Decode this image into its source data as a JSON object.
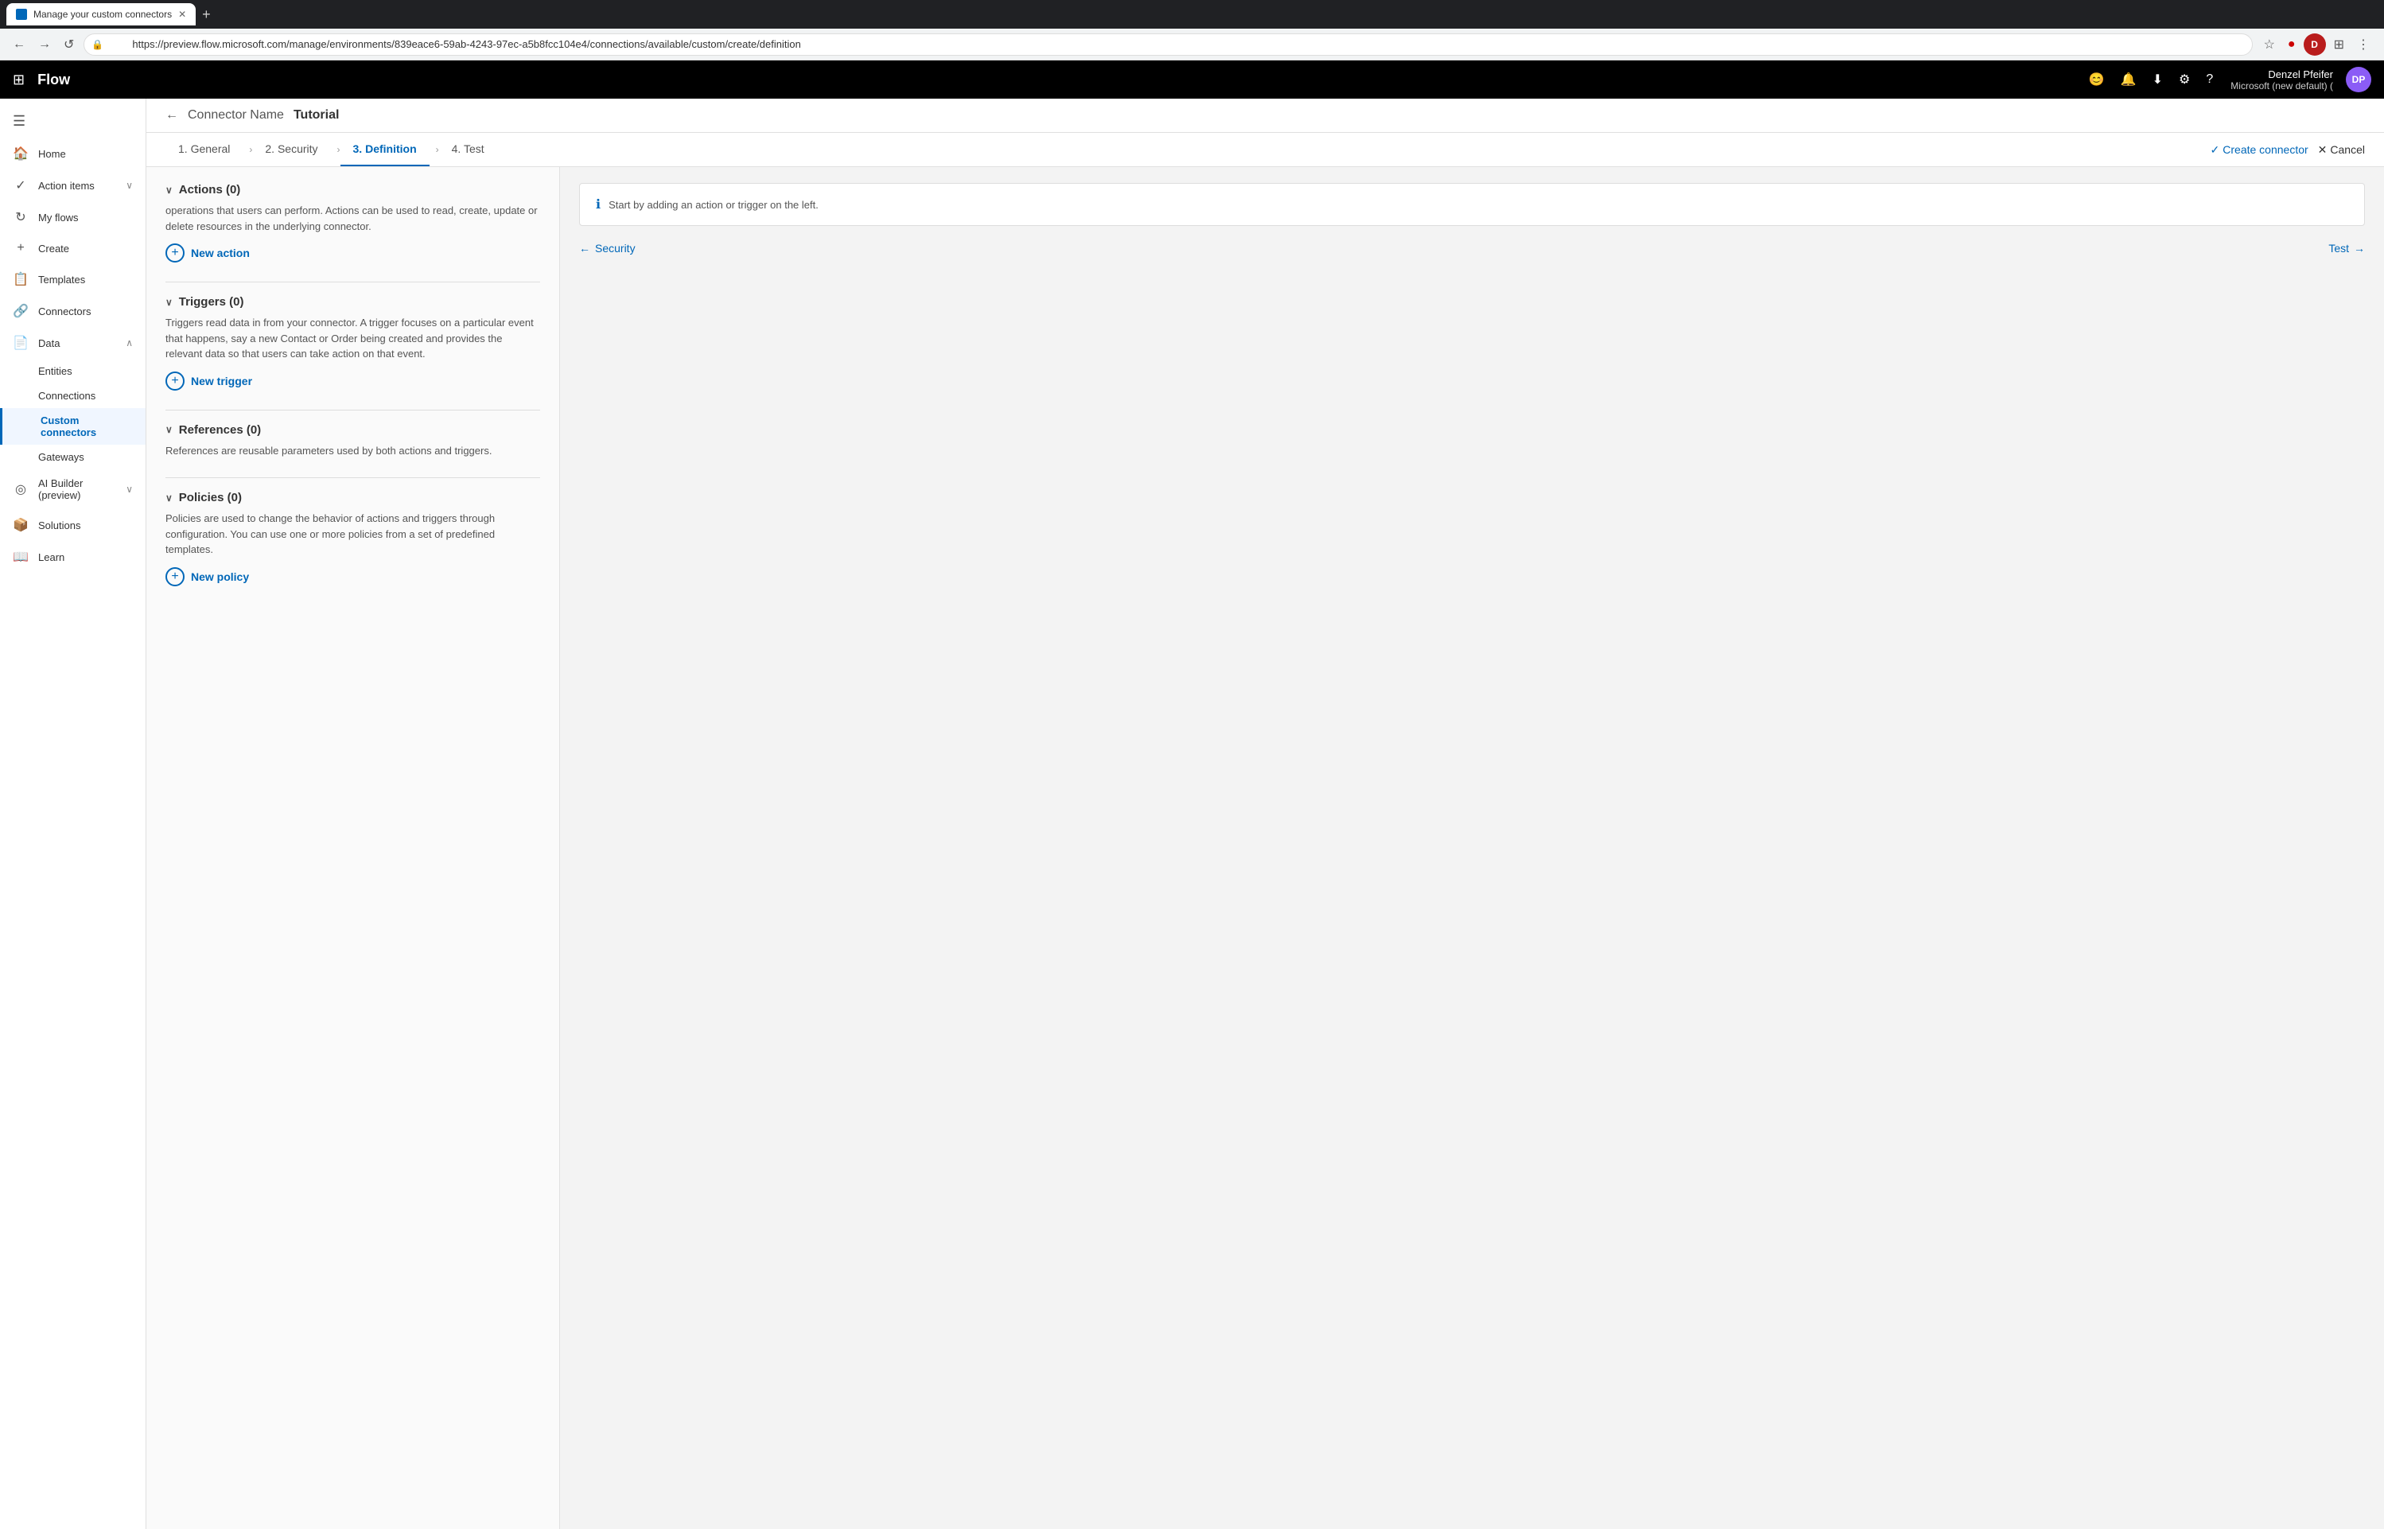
{
  "browser": {
    "tab_title": "Manage your custom connectors",
    "url": "https://preview.flow.microsoft.com/manage/environments/839eace6-59ab-4243-97ec-a5b8fcc104e4/connections/available/custom/create/definition",
    "nav_back_label": "←",
    "nav_forward_label": "→",
    "nav_refresh_label": "↺",
    "new_tab_label": "+"
  },
  "topnav": {
    "app_name": "Flow",
    "user_name": "Denzel Pfeifer",
    "user_tenant": "Microsoft (new default) (",
    "icons": [
      "😊",
      "🔔",
      "⬇",
      "⚙",
      "?"
    ],
    "avatar_initials": "DP"
  },
  "sidebar": {
    "hamburger_label": "☰",
    "items": [
      {
        "id": "home",
        "label": "Home",
        "icon": "🏠",
        "has_expand": false
      },
      {
        "id": "action-items",
        "label": "Action items",
        "icon": "✓",
        "has_expand": true
      },
      {
        "id": "my-flows",
        "label": "My flows",
        "icon": "↻",
        "has_expand": false
      },
      {
        "id": "create",
        "label": "Create",
        "icon": "+",
        "has_expand": false
      },
      {
        "id": "templates",
        "label": "Templates",
        "icon": "📋",
        "has_expand": false
      },
      {
        "id": "connectors",
        "label": "Connectors",
        "icon": "🔗",
        "has_expand": false
      },
      {
        "id": "data",
        "label": "Data",
        "icon": "📄",
        "has_expand": true
      },
      {
        "id": "entities",
        "label": "Entities",
        "icon": "",
        "is_sub": true
      },
      {
        "id": "connections",
        "label": "Connections",
        "icon": "",
        "is_sub": true
      },
      {
        "id": "custom-connectors",
        "label": "Custom connectors",
        "icon": "",
        "is_sub": true,
        "active": true
      },
      {
        "id": "gateways",
        "label": "Gateways",
        "icon": "",
        "is_sub": true
      },
      {
        "id": "ai-builder",
        "label": "AI Builder\n(preview)",
        "icon": "◎",
        "has_expand": true
      },
      {
        "id": "solutions",
        "label": "Solutions",
        "icon": "📦",
        "has_expand": false
      },
      {
        "id": "learn",
        "label": "Learn",
        "icon": "📖",
        "has_expand": false
      }
    ]
  },
  "connector_header": {
    "connector_name": "Connector Name",
    "title": "Tutorial",
    "back_icon": "←"
  },
  "wizard_tabs": [
    {
      "id": "general",
      "label": "1. General",
      "active": false
    },
    {
      "id": "security",
      "label": "2. Security",
      "active": false
    },
    {
      "id": "definition",
      "label": "3. Definition",
      "active": true
    },
    {
      "id": "test",
      "label": "4. Test",
      "active": false
    }
  ],
  "wizard_actions": {
    "create_label": "Create connector",
    "cancel_label": "Cancel"
  },
  "definition": {
    "actions_section": {
      "title": "Actions (0)",
      "description": "operations that users can perform. Actions can be used to read, create, update or delete resources in the underlying connector.",
      "add_label": "New action"
    },
    "triggers_section": {
      "title": "Triggers (0)",
      "description": "Triggers read data in from your connector. A trigger focuses on a particular event that happens, say a new Contact or Order being created and provides the relevant data so that users can take action on that event.",
      "add_label": "New trigger"
    },
    "references_section": {
      "title": "References (0)",
      "description": "References are reusable parameters used by both actions and triggers.",
      "add_label": null
    },
    "policies_section": {
      "title": "Policies (0)",
      "description": "Policies are used to change the behavior of actions and triggers through configuration. You can use one or more policies from a set of predefined templates.",
      "add_label": "New policy"
    },
    "right_panel": {
      "info_text": "Start by adding an action or trigger on the left.",
      "nav_left_label": "Security",
      "nav_right_label": "Test"
    }
  }
}
